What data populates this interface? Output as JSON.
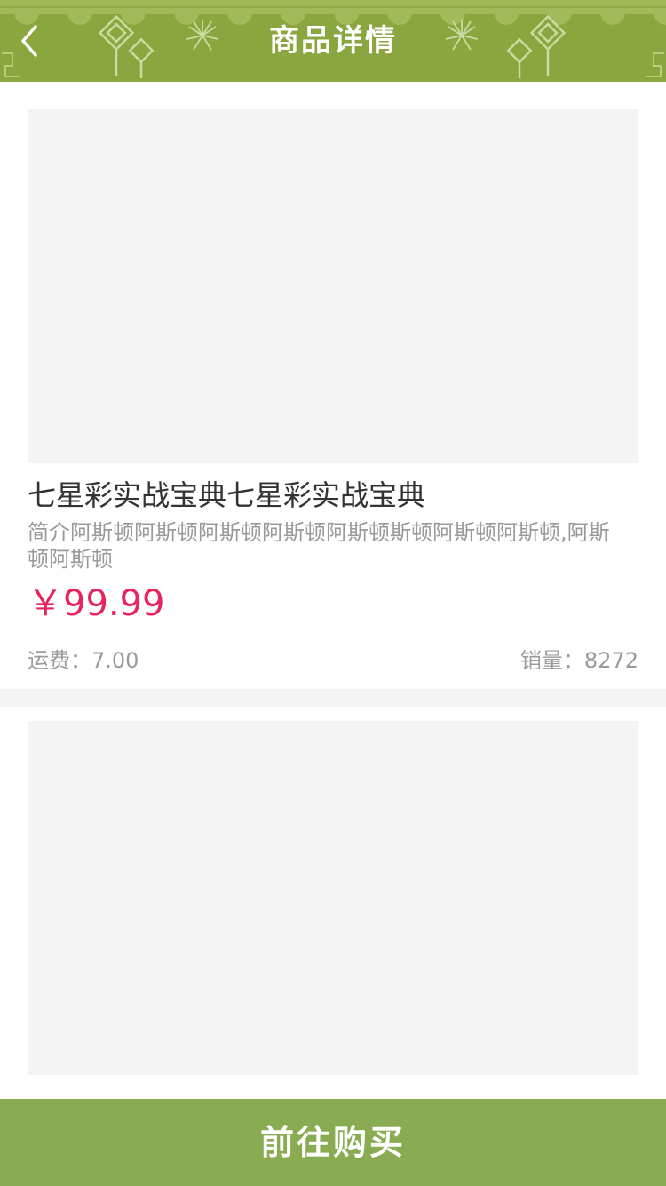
{
  "header": {
    "title": "商品详情",
    "back_icon": "chevron-left-icon",
    "background_color": "#8aa63f"
  },
  "product": {
    "image_placeholder_color": "#f4f4f4",
    "title": "七星彩实战宝典七星彩实战宝典",
    "description": "简介阿斯顿阿斯顿阿斯顿阿斯顿阿斯顿斯顿阿斯顿阿斯顿,阿斯顿阿斯顿",
    "price": "￥99.99",
    "price_color": "#e8245e",
    "shipping": "运费：7.00",
    "sales": "销量：8272"
  },
  "detail": {
    "image_placeholder_color": "#f4f4f4"
  },
  "footer": {
    "buy_label": "前往购买",
    "button_color": "#89ab52"
  }
}
